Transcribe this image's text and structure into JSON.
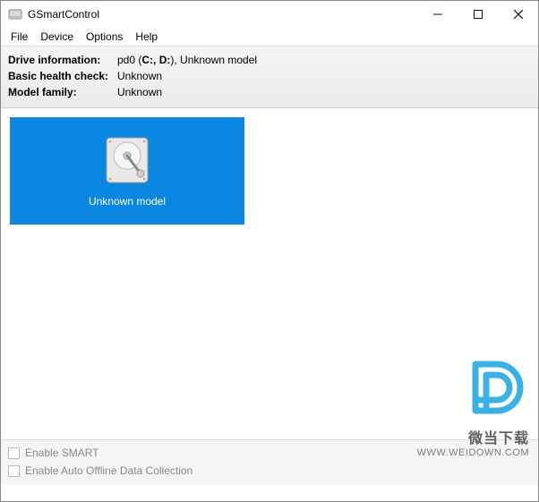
{
  "window": {
    "title": "GSmartControl"
  },
  "menu": {
    "file": "File",
    "device": "Device",
    "options": "Options",
    "help": "Help"
  },
  "info": {
    "driveInfoLabel": "Drive information:",
    "driveInfoPrefix": "pd0 (",
    "driveInfoBold": "C:, D:",
    "driveInfoSuffix": "), Unknown model",
    "healthLabel": "Basic health check:",
    "healthValue": "Unknown",
    "modelFamilyLabel": "Model family:",
    "modelFamilyValue": "Unknown"
  },
  "drive": {
    "label": "Unknown model"
  },
  "bottom": {
    "enableSmart": "Enable SMART",
    "enableAuto": "Enable Auto Offline Data Collection"
  },
  "watermark": {
    "line1": "微当下载",
    "line2": "WWW.WEIDOWN.COM"
  }
}
